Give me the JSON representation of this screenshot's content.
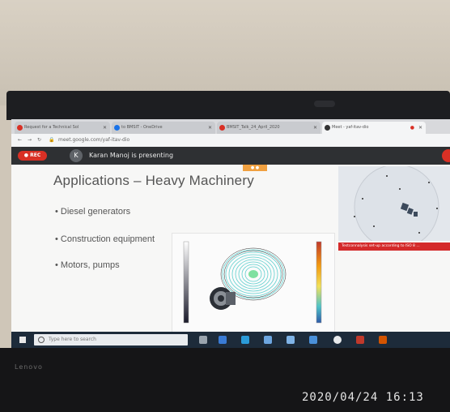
{
  "browser": {
    "tabs": [
      {
        "label": "Request for a Technical Sol",
        "icon_color": "#d93025"
      },
      {
        "label": "to BMSIT - OneDrive",
        "icon_color": "#1a73e8"
      },
      {
        "label": "BMSIT_Talk_24_April_2020",
        "icon_color": "#d93025"
      },
      {
        "label": "Meet - yaf-itav-dio",
        "icon_color": "#333333"
      }
    ],
    "url": "meet.google.com/yaf-itav-dio"
  },
  "meet": {
    "rec_label": "REC",
    "avatar_initial": "K",
    "presenting_text": "Karan Manoj is presenting"
  },
  "slide": {
    "title": "Applications – Heavy Machinery",
    "bullets": [
      "Diesel generators",
      "Construction equipment",
      "Motors, pumps"
    ],
    "caption": "Testconnalysis set-up according to ISO 8 ..."
  },
  "taskbar": {
    "search_placeholder": "Type here to search"
  },
  "laptop": {
    "brand": "Lenovo"
  },
  "photo": {
    "timestamp": "2020/04/24  16:13"
  }
}
